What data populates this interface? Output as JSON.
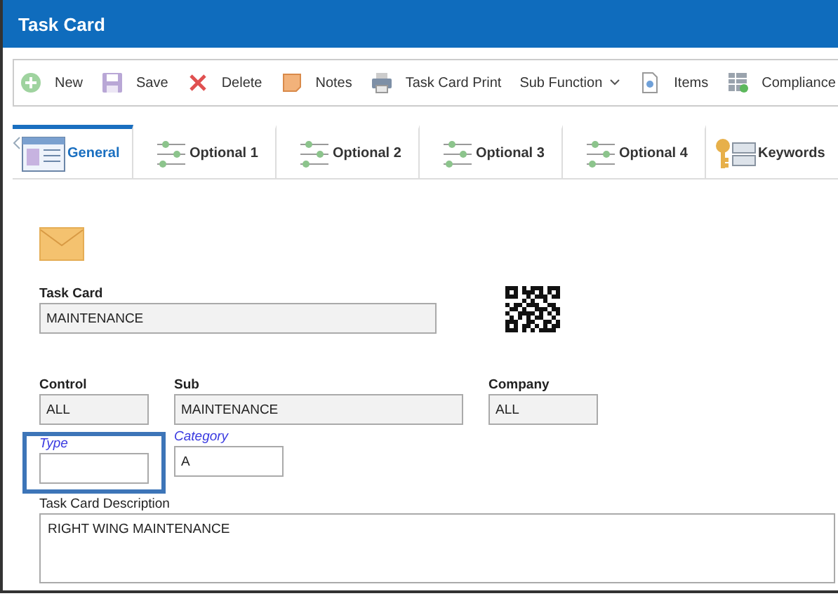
{
  "window": {
    "title": "Task Card"
  },
  "toolbar": [
    {
      "label": "New"
    },
    {
      "label": "Save"
    },
    {
      "label": "Delete"
    },
    {
      "label": "Notes"
    },
    {
      "label": "Task Card Print"
    },
    {
      "label": "Sub Function"
    },
    {
      "label": "Items"
    },
    {
      "label": "Compliance"
    }
  ],
  "tabs": [
    {
      "label": "General",
      "selected": true
    },
    {
      "label": "Optional 1",
      "selected": false
    },
    {
      "label": "Optional 2",
      "selected": false
    },
    {
      "label": "Optional 3",
      "selected": false
    },
    {
      "label": "Optional 4",
      "selected": false
    },
    {
      "label": "Keywords",
      "selected": false
    }
  ],
  "rows": [
    [
      {
        "label": "Task Card",
        "value": "MAINTENANCE",
        "kind": "readonly",
        "required": false,
        "focused": false
      }
    ],
    [
      {
        "label": "Control",
        "value": "ALL",
        "kind": "readonly",
        "required": false,
        "focused": false
      },
      {
        "label": "Sub",
        "value": "MAINTENANCE",
        "kind": "readonly",
        "required": false,
        "focused": false
      },
      {
        "label": "Company",
        "value": "ALL",
        "kind": "readonly",
        "required": false,
        "focused": false
      }
    ],
    [
      {
        "label": "Type",
        "kind": "input",
        "required": true,
        "focused": true
      },
      {
        "label": "Category",
        "value": "A",
        "kind": "input",
        "required": true,
        "focused": false
      }
    ],
    [
      {
        "label": "Task Card Description",
        "value": "RIGHT WING MAINTENANCE",
        "kind": "textarea",
        "required": false,
        "focused": false
      }
    ]
  ]
}
